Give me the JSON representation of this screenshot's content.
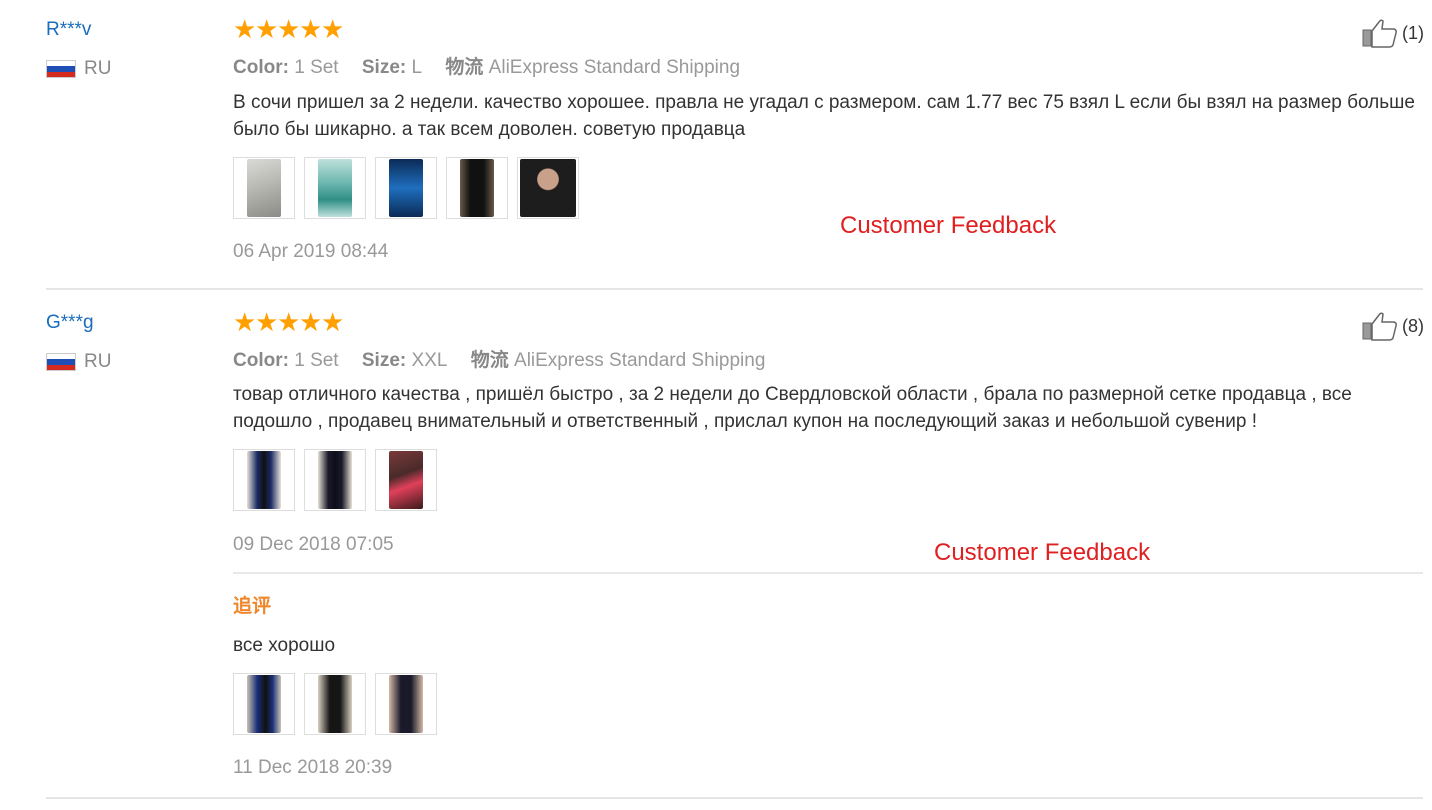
{
  "reviews": [
    {
      "user": "R***v",
      "country": "RU",
      "stars": 5,
      "helpful_count": "(1)",
      "color_label": "Color:",
      "color_value": "1 Set",
      "size_label": "Size:",
      "size_value": "L",
      "shipping_label": "物流",
      "shipping_value": "AliExpress Standard Shipping",
      "text": "В сочи пришел за 2 недели. качество хорошее. правла не угадал с размером. сам 1.77 вес 75 взял L если бы взял на размер больше было бы шикарно. а так всем доволен. советую продавца",
      "photos": [
        {
          "bg": "#d9d9d6",
          "fg": "#8a8a86"
        },
        {
          "bg": "#bfe0dc",
          "fg": "#2f8f87"
        },
        {
          "bg": "#0b2a55",
          "fg": "#1f6fbf"
        },
        {
          "bg": "#3a3a3a",
          "fg": "#111111"
        },
        {
          "bg": "#5a4a3a",
          "fg": "#1d1d1d"
        }
      ],
      "date": "06 Apr 2019 08:44",
      "watermark": "Customer Feedback"
    },
    {
      "user": "G***g",
      "country": "RU",
      "stars": 5,
      "helpful_count": "(8)",
      "color_label": "Color:",
      "color_value": "1 Set",
      "size_label": "Size:",
      "size_value": "XXL",
      "shipping_label": "物流",
      "shipping_value": "AliExpress Standard Shipping",
      "text": "товар отличного качества , пришёл быстро , за 2 недели до Свердловской области , брала по размерной сетке продавца , все подошло , продавец внимательный и ответственный , прислал купон на последующий заказ и небольшой сувенир !",
      "photos": [
        {
          "bg": "#e8e2d6",
          "fg": "#1c2a66"
        },
        {
          "bg": "#e6e0d4",
          "fg": "#1a1a2a"
        },
        {
          "bg": "#7a3a3a",
          "fg": "#e0405a"
        }
      ],
      "date": "09 Dec 2018 07:05",
      "watermark": "Customer Feedback",
      "additional": {
        "label": "追评",
        "text": "все хорошо",
        "photos": [
          {
            "bg": "#c9c2b2",
            "fg": "#1a2f7a"
          },
          {
            "bg": "#d8cfc0",
            "fg": "#151515"
          },
          {
            "bg": "#d4b9a8",
            "fg": "#1a1a2a"
          }
        ],
        "date": "11 Dec 2018 20:39"
      }
    }
  ],
  "colors": {
    "accent_star": "#ff9f00",
    "username": "#1a6dbb",
    "watermark": "#e02020",
    "additional_label": "#f0862a"
  }
}
